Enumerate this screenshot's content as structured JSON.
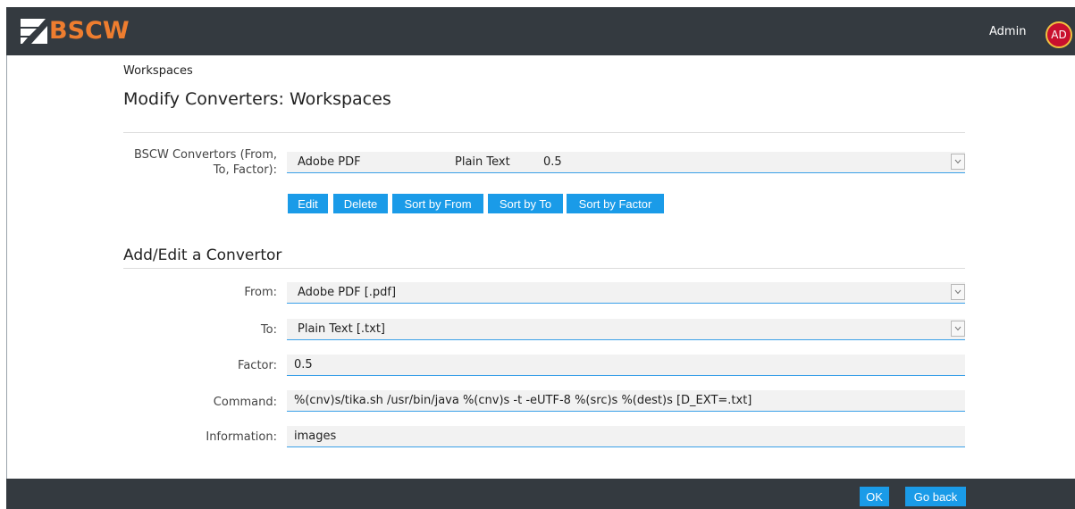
{
  "header": {
    "logo_text": "BSCW",
    "user_name": "Admin",
    "avatar_initials": "AD",
    "brand_color": "#ee7d2f",
    "bar_color": "#343a40"
  },
  "breadcrumb": "Workspaces",
  "page_title": "Modify Converters: Workspaces",
  "converters": {
    "label": "BSCW Convertors (From, To, Factor):",
    "label_line1": "BSCW Convertors (From,",
    "label_line2": "To, Factor):",
    "selected": {
      "from": "Adobe PDF",
      "to": "Plain Text",
      "factor": "0.5"
    },
    "buttons": {
      "edit": "Edit",
      "delete": "Delete",
      "sort_from": "Sort by From",
      "sort_to": "Sort by To",
      "sort_factor": "Sort by Factor"
    }
  },
  "form": {
    "section_title": "Add/Edit a Convertor",
    "from": {
      "label": "From:",
      "value": "Adobe PDF [.pdf]"
    },
    "to": {
      "label": "To:",
      "value": "Plain Text [.txt]"
    },
    "factor": {
      "label": "Factor:",
      "value": "0.5"
    },
    "command": {
      "label": "Command:",
      "value": "%(cnv)s/tika.sh /usr/bin/java %(cnv)s -t -eUTF-8 %(src)s %(dest)s [D_EXT=.txt]"
    },
    "information": {
      "label": "Information:",
      "value": "images"
    }
  },
  "footer": {
    "ok": "OK",
    "go_back": "Go back"
  },
  "accent_color": "#1a9be8"
}
